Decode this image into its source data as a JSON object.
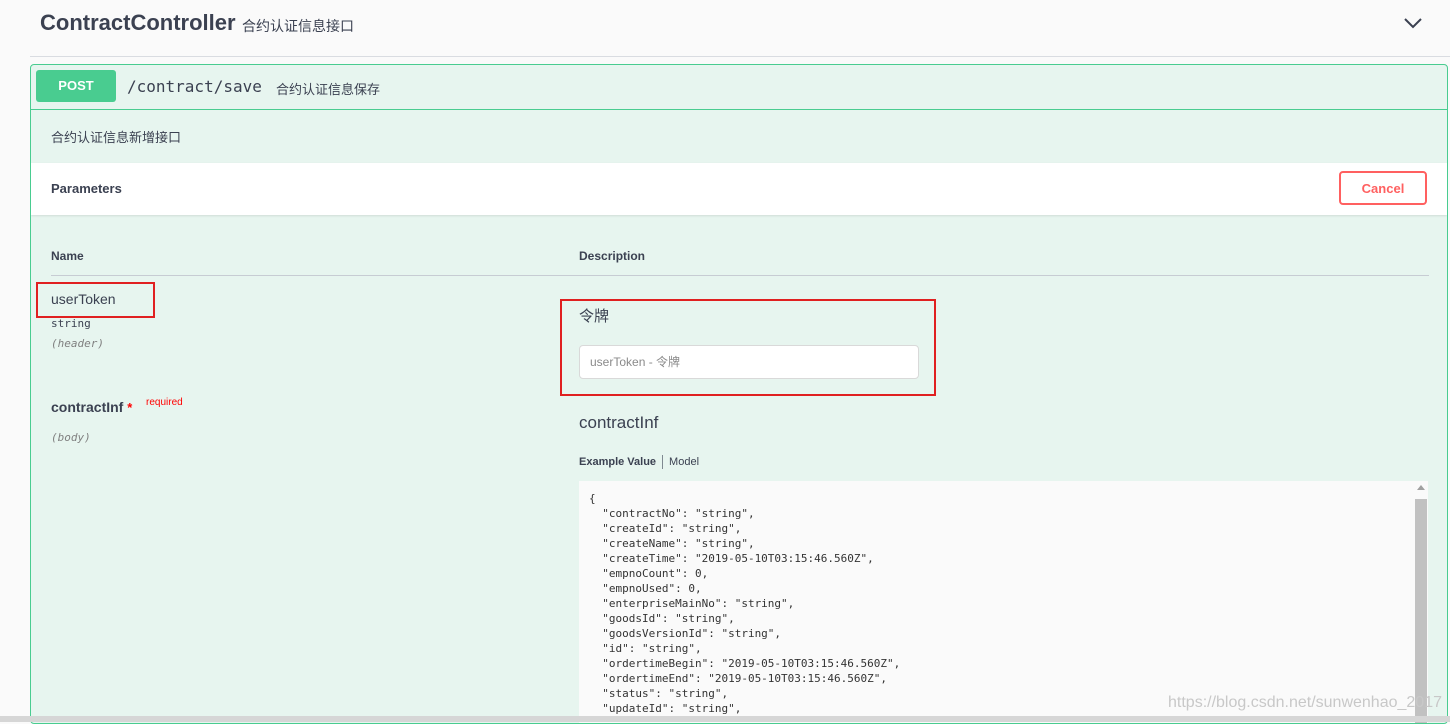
{
  "tag": {
    "title": "ContractController",
    "description": "合约认证信息接口",
    "toggle_icon": "chevron-down-icon"
  },
  "operation": {
    "method": "POST",
    "path": "/contract/save",
    "summary": "合约认证信息保存",
    "description": "合约认证信息新增接口",
    "accent_color": "#49cc90"
  },
  "parameters": {
    "title": "Parameters",
    "cancel_label": "Cancel",
    "columns": {
      "name": "Name",
      "description": "Description"
    },
    "items": [
      {
        "name": "userToken",
        "type": "string",
        "in": "(header)",
        "description": "令牌",
        "input_placeholder": "userToken - 令牌"
      },
      {
        "name": "contractInf",
        "required_star": "*",
        "required_label": "required",
        "in": "(body)",
        "description": "contractInf",
        "tabs": {
          "example": "Example Value",
          "model": "Model"
        },
        "example_json": "{\n  \"contractNo\": \"string\",\n  \"createId\": \"string\",\n  \"createName\": \"string\",\n  \"createTime\": \"2019-05-10T03:15:46.560Z\",\n  \"empnoCount\": 0,\n  \"empnoUsed\": 0,\n  \"enterpriseMainNo\": \"string\",\n  \"goodsId\": \"string\",\n  \"goodsVersionId\": \"string\",\n  \"id\": \"string\",\n  \"ordertimeBegin\": \"2019-05-10T03:15:46.560Z\",\n  \"ordertimeEnd\": \"2019-05-10T03:15:46.560Z\",\n  \"status\": \"string\",\n  \"updateId\": \"string\","
      }
    ]
  },
  "watermark": "https://blog.csdn.net/sunwenhao_2017",
  "colors": {
    "cancel": "#ff6060",
    "highlight_box": "#e02020",
    "required": "#ff0000"
  }
}
